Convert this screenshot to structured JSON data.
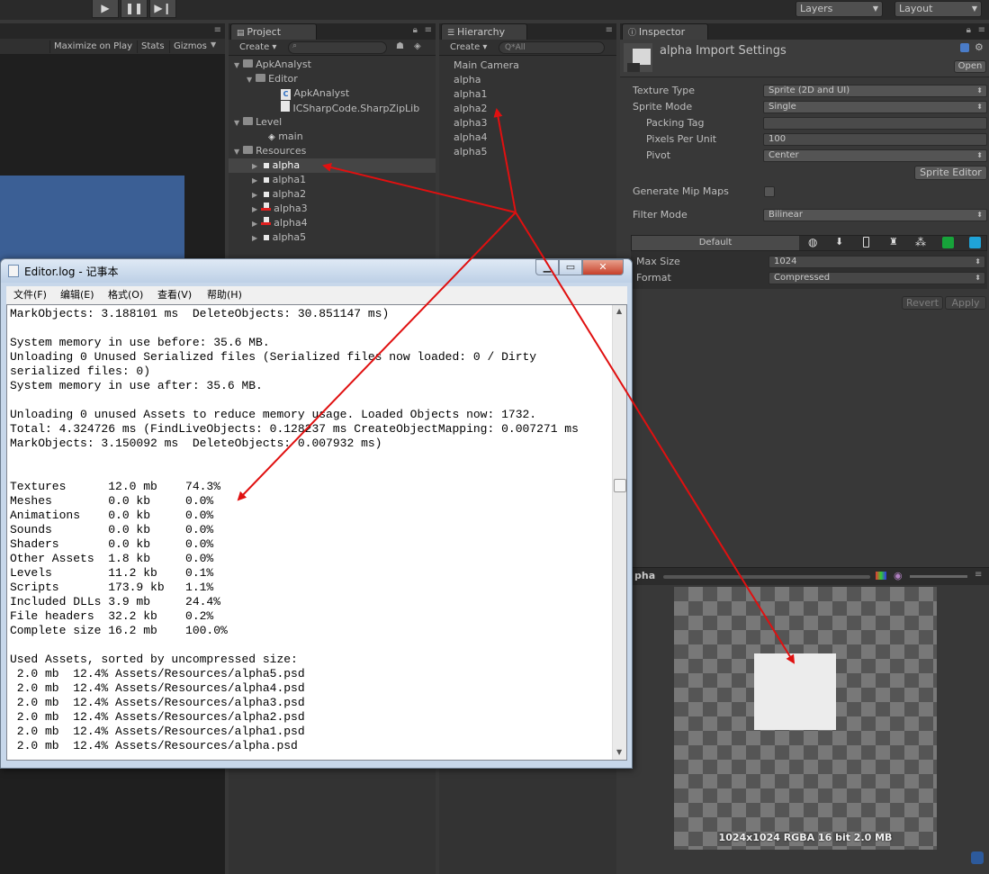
{
  "toolbar": {
    "play_icon": "play-icon",
    "pause_icon": "pause-icon",
    "step_icon": "step-icon",
    "layers": "Layers",
    "layout": "Layout"
  },
  "game": {
    "maximize_on_play": "Maximize on Play",
    "stats": "Stats",
    "gizmos": "Gizmos"
  },
  "project": {
    "tab": "Project",
    "create": "Create",
    "tree": [
      {
        "label": "ApkAnalyst",
        "type": "folder",
        "depth": 0
      },
      {
        "label": "Editor",
        "type": "folder",
        "depth": 1
      },
      {
        "label": "ApkAnalyst",
        "type": "script",
        "depth": 2
      },
      {
        "label": "ICSharpCode.SharpZipLib",
        "type": "document",
        "depth": 2
      },
      {
        "label": "Level",
        "type": "folder",
        "depth": 0
      },
      {
        "label": "main",
        "type": "scene",
        "depth": 1
      },
      {
        "label": "Resources",
        "type": "folder",
        "depth": 0
      },
      {
        "label": "alpha",
        "type": "sprite",
        "depth": 1,
        "selected": true
      },
      {
        "label": "alpha1",
        "type": "sprite",
        "depth": 1
      },
      {
        "label": "alpha2",
        "type": "sprite",
        "depth": 1
      },
      {
        "label": "alpha3",
        "type": "sprite-red",
        "depth": 1
      },
      {
        "label": "alpha4",
        "type": "sprite-red",
        "depth": 1
      },
      {
        "label": "alpha5",
        "type": "sprite",
        "depth": 1
      }
    ]
  },
  "hierarchy": {
    "tab": "Hierarchy",
    "create": "Create",
    "search_placeholder": "Q*All",
    "items": [
      "Main Camera",
      "alpha",
      "alpha1",
      "alpha2",
      "alpha3",
      "alpha4",
      "alpha5"
    ]
  },
  "inspector": {
    "tab": "Inspector",
    "title": "alpha Import Settings",
    "open": "Open",
    "texture_type": {
      "label": "Texture Type",
      "value": "Sprite (2D and UI)"
    },
    "sprite_mode": {
      "label": "Sprite Mode",
      "value": "Single"
    },
    "packing_tag": {
      "label": "Packing Tag",
      "value": ""
    },
    "pixels_per_unit": {
      "label": "Pixels Per Unit",
      "value": "100"
    },
    "pivot": {
      "label": "Pivot",
      "value": "Center"
    },
    "sprite_editor": "Sprite Editor",
    "generate_mip_maps": {
      "label": "Generate Mip Maps",
      "checked": false
    },
    "filter_mode": {
      "label": "Filter Mode",
      "value": "Bilinear"
    },
    "platform_default": "Default",
    "platform_icons": [
      "globe-icon",
      "download-icon",
      "phone-icon",
      "android-icon",
      "blackberry-icon",
      "xbox-icon",
      "windows-store-icon"
    ],
    "max_size": {
      "label": "Max Size",
      "value": "1024"
    },
    "format": {
      "label": "Format",
      "value": "Compressed"
    },
    "revert": "Revert",
    "apply": "Apply",
    "preview_label": "pha",
    "preview_info": "1024x1024  RGBA 16 bit  2.0 MB"
  },
  "notepad": {
    "title": "Editor.log - 记事本",
    "menu": [
      "文件(F)",
      "编辑(E)",
      "格式(O)",
      "查看(V)",
      "帮助(H)"
    ],
    "lines": [
      "MarkObjects: 3.188101 ms  DeleteObjects: 30.851147 ms)",
      "",
      "System memory in use before: 35.6 MB.",
      "Unloading 0 Unused Serialized files (Serialized files now loaded: 0 / Dirty",
      "serialized files: 0)",
      "System memory in use after: 35.6 MB.",
      "",
      "Unloading 0 unused Assets to reduce memory usage. Loaded Objects now: 1732.",
      "Total: 4.324726 ms (FindLiveObjects: 0.128237 ms CreateObjectMapping: 0.007271 ms",
      "MarkObjects: 3.150092 ms  DeleteObjects: 0.007932 ms)",
      "",
      "",
      "Textures      12.0 mb    74.3%",
      "Meshes        0.0 kb     0.0%",
      "Animations    0.0 kb     0.0%",
      "Sounds        0.0 kb     0.0%",
      "Shaders       0.0 kb     0.0%",
      "Other Assets  1.8 kb     0.0%",
      "Levels        11.2 kb    0.1%",
      "Scripts       173.9 kb   1.1%",
      "Included DLLs 3.9 mb     24.4%",
      "File headers  32.2 kb    0.2%",
      "Complete size 16.2 mb    100.0%",
      "",
      "Used Assets, sorted by uncompressed size:",
      " 2.0 mb  12.4% Assets/Resources/alpha5.psd",
      " 2.0 mb  12.4% Assets/Resources/alpha4.psd",
      " 2.0 mb  12.4% Assets/Resources/alpha3.psd",
      " 2.0 mb  12.4% Assets/Resources/alpha2.psd",
      " 2.0 mb  12.4% Assets/Resources/alpha1.psd",
      " 2.0 mb  12.4% Assets/Resources/alpha.psd"
    ]
  },
  "colors": {
    "annotation_red": "#e01010",
    "unity_dark": "#383838",
    "scene_blue": "#3b5f95"
  }
}
